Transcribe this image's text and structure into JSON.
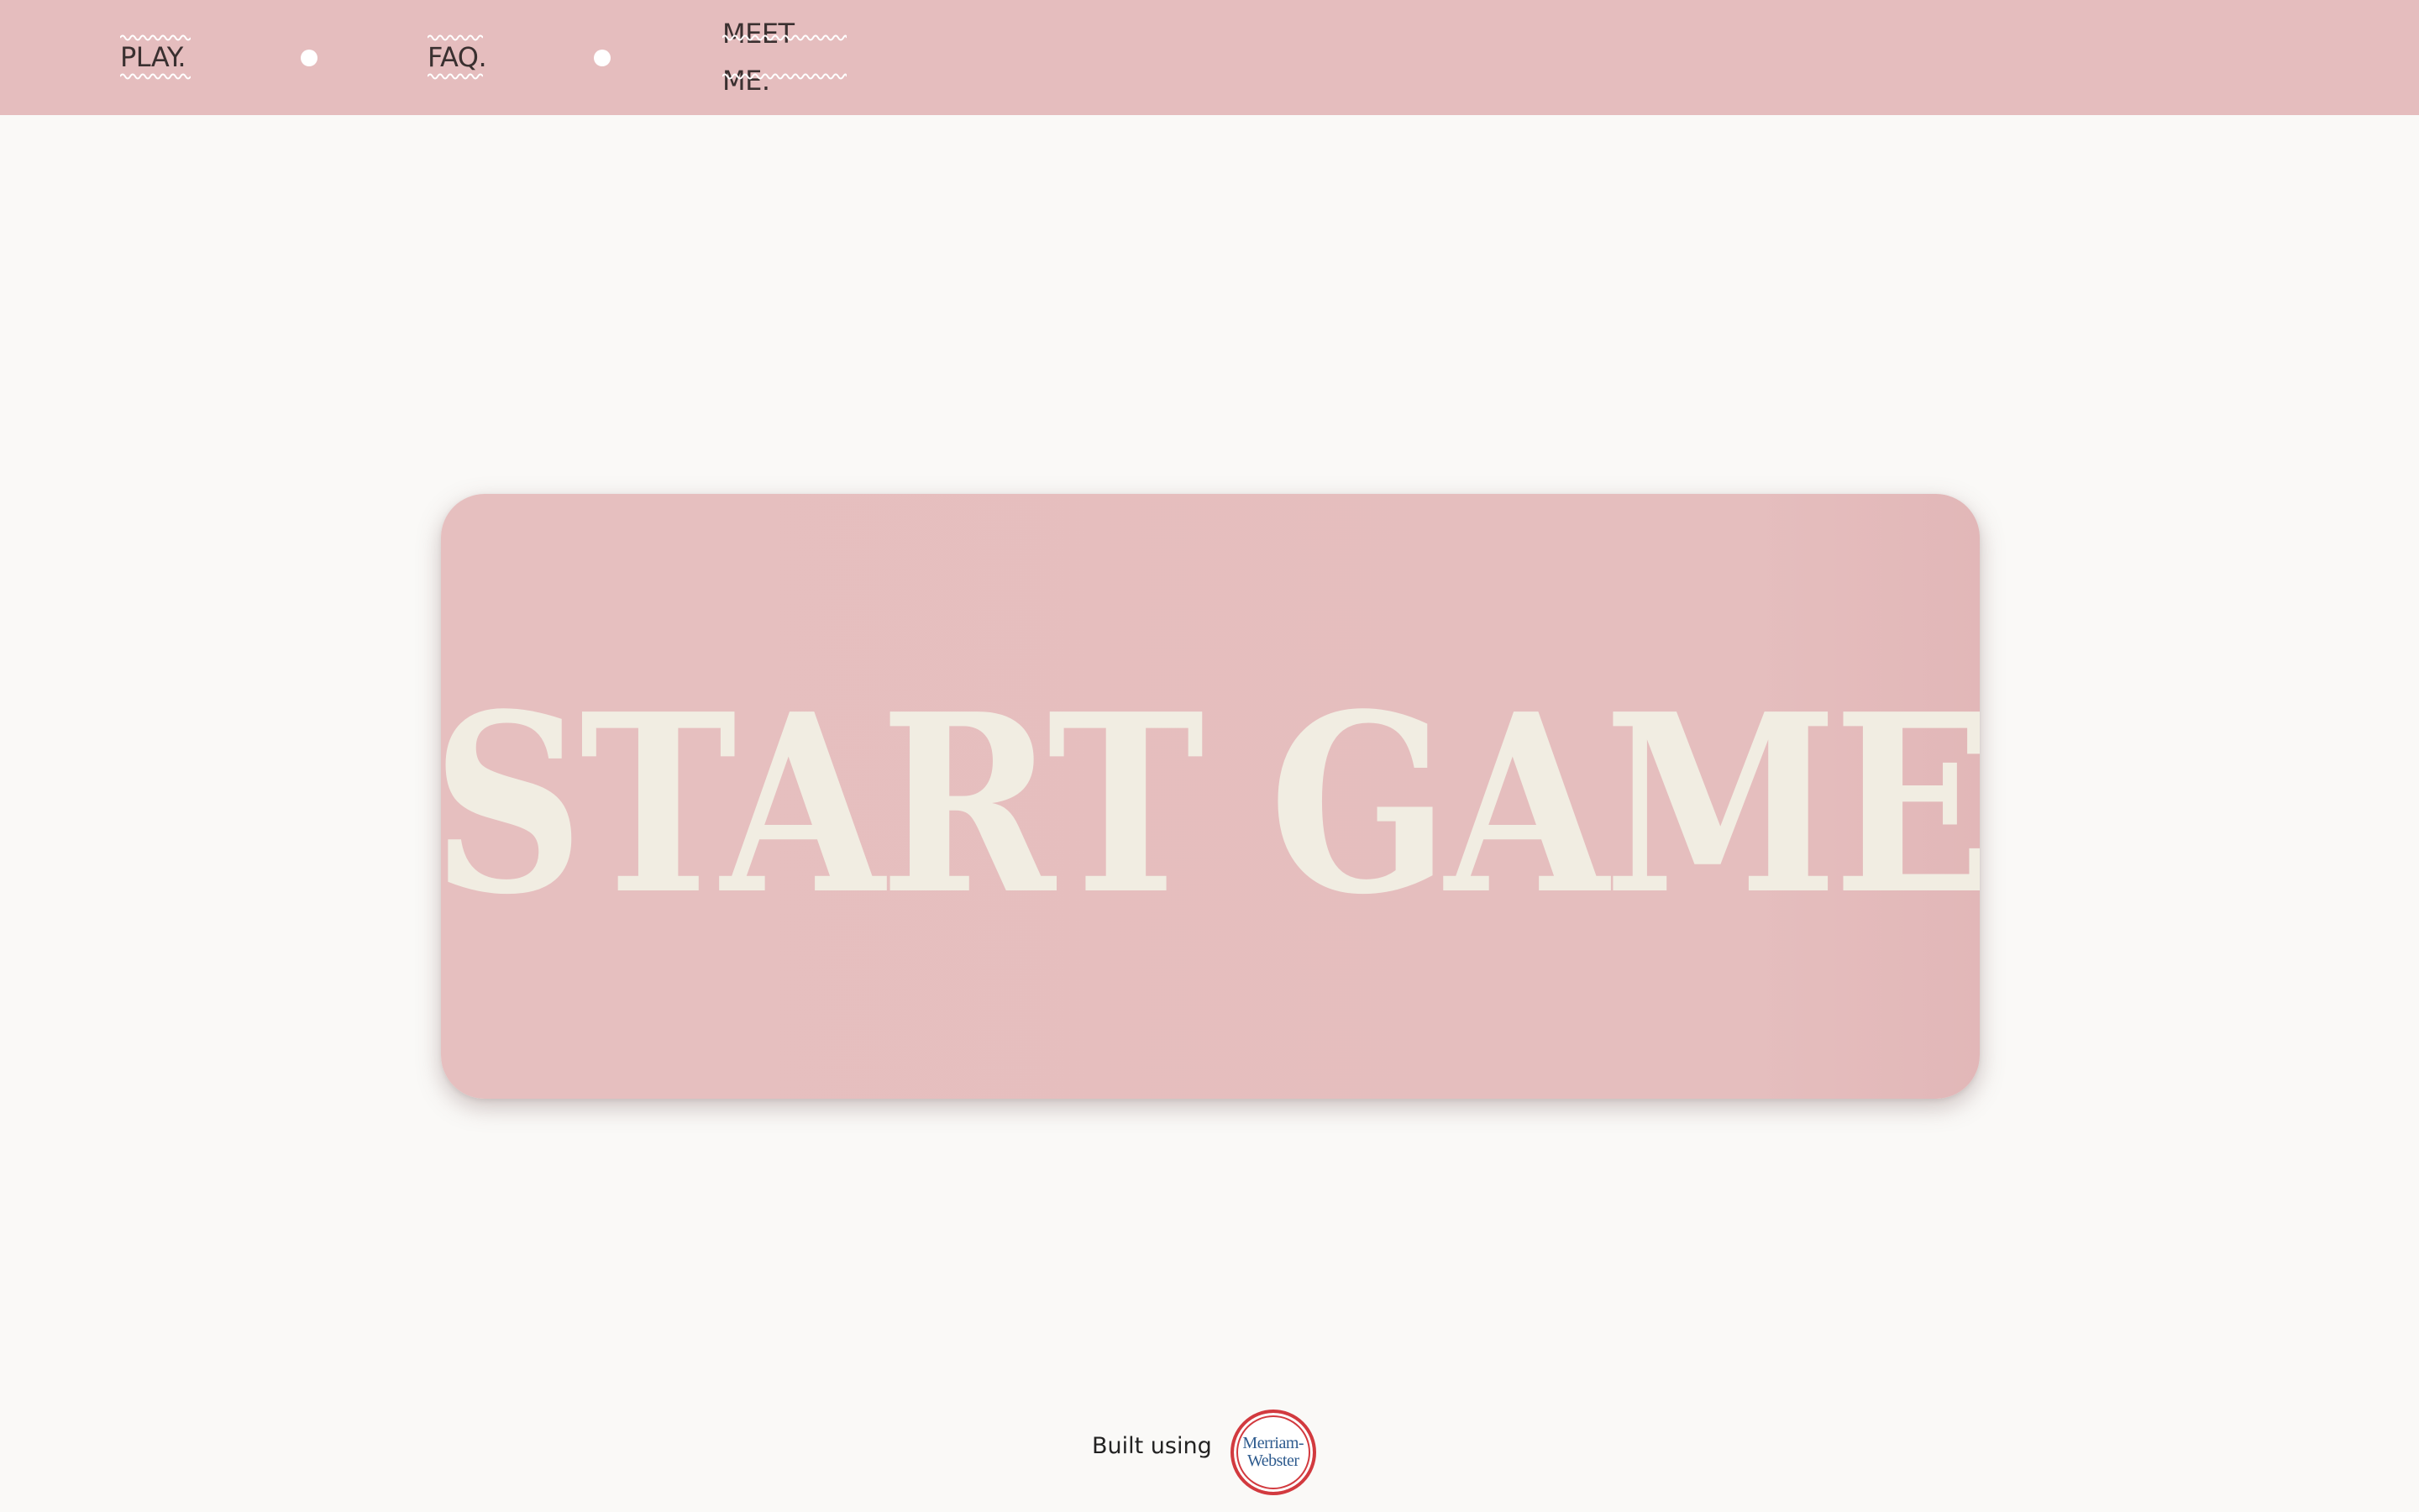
{
  "nav": {
    "items": [
      {
        "label": "PLAY."
      },
      {
        "label": "FAQ."
      },
      {
        "label": "MEET ME."
      }
    ]
  },
  "main": {
    "start_button_label": "START GAME"
  },
  "footer": {
    "built_using_text": "Built using",
    "logo": {
      "line1": "Merriam-",
      "line2": "Webster"
    }
  },
  "colors": {
    "nav_background": "#e5bdbe",
    "page_background": "#faf9f7",
    "card_background": "#e5bebe",
    "card_text": "#f1ede2",
    "logo_ring": "#d23a3f",
    "logo_text": "#2e5b8e"
  }
}
